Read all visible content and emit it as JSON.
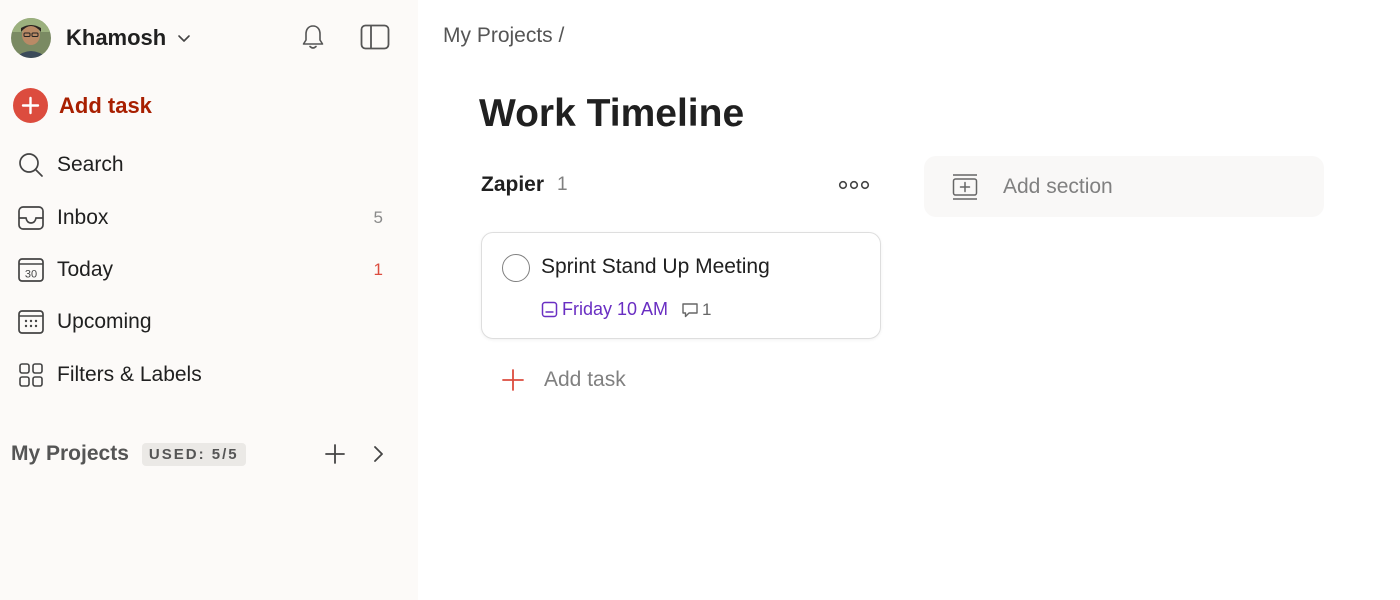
{
  "user": {
    "name": "Khamosh"
  },
  "sidebar": {
    "add_task_label": "Add task",
    "items": [
      {
        "label": "Search",
        "icon": "search-icon",
        "count": ""
      },
      {
        "label": "Inbox",
        "icon": "inbox-icon",
        "count": "5"
      },
      {
        "label": "Today",
        "icon": "calendar-today-icon",
        "icon_text": "30",
        "count": "1"
      },
      {
        "label": "Upcoming",
        "icon": "calendar-grid-icon",
        "count": ""
      },
      {
        "label": "Filters & Labels",
        "icon": "grid-icon",
        "count": ""
      }
    ],
    "projects": {
      "label": "My Projects",
      "badge": "USED: 5/5"
    }
  },
  "main": {
    "breadcrumb": "My Projects",
    "breadcrumb_sep": "/",
    "title": "Work Timeline",
    "section": {
      "name": "Zapier",
      "count": "1",
      "add_task_label": "Add task",
      "tasks": [
        {
          "title": "Sprint Stand Up Meeting",
          "due": "Friday 10 AM",
          "comments": "1"
        }
      ]
    },
    "add_section_label": "Add section"
  },
  "colors": {
    "accent": "#dc4c3e",
    "add_task_text": "#a81f00",
    "date_purple": "#692ec2",
    "sidebar_bg": "#fcfaf8"
  }
}
